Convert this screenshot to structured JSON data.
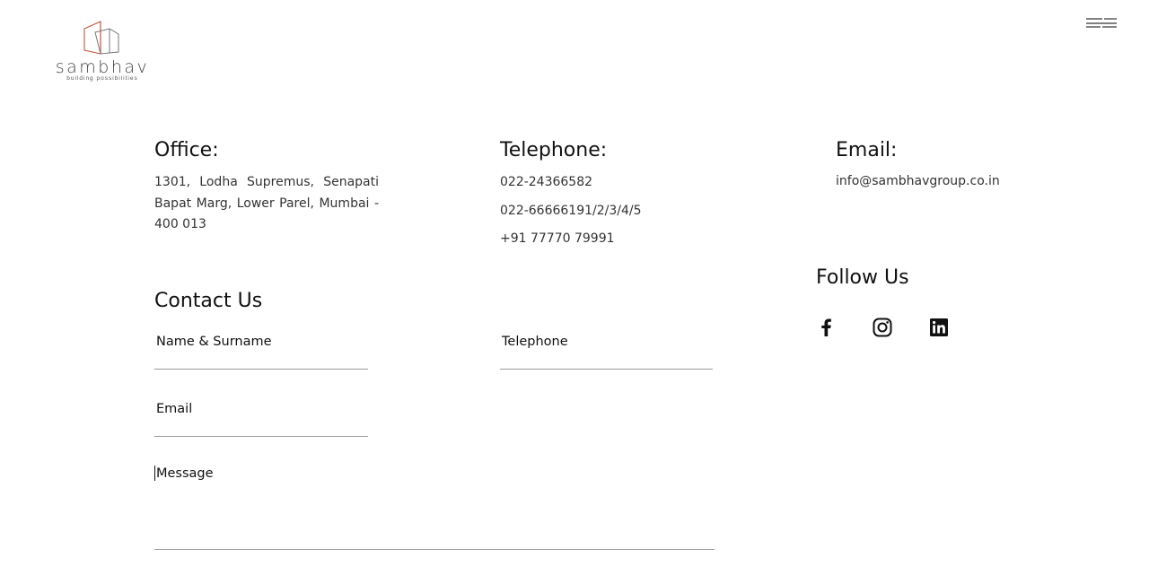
{
  "logo": {
    "wordmark": "sambhav",
    "tagline": "building possibilities"
  },
  "menu": {
    "icon": "hamburger-menu-icon"
  },
  "office": {
    "heading": "Office:",
    "address": "1301, Lodha Supremus, Senapati Bapat Marg, Lower Parel, Mumbai - 400 013"
  },
  "telephone": {
    "heading": "Telephone:",
    "numbers": [
      "022-24366582",
      "022-66666191/2/3/4/5",
      "+91 77770 79991"
    ]
  },
  "email": {
    "heading": "Email:",
    "address": "info@sambhavgroup.co.in"
  },
  "follow": {
    "heading": "Follow Us",
    "icons": [
      "facebook-icon",
      "instagram-icon",
      "linkedin-icon"
    ]
  },
  "contact": {
    "heading": "Contact Us",
    "fields": {
      "name_label": "Name & Surname",
      "telephone_label": "Telephone",
      "email_label": "Email",
      "message_label": "Message"
    }
  },
  "colors": {
    "logo_accent": "#c0573a",
    "logo_gray": "#777777",
    "text": "#333333",
    "field_line": "#9a9a9a"
  }
}
